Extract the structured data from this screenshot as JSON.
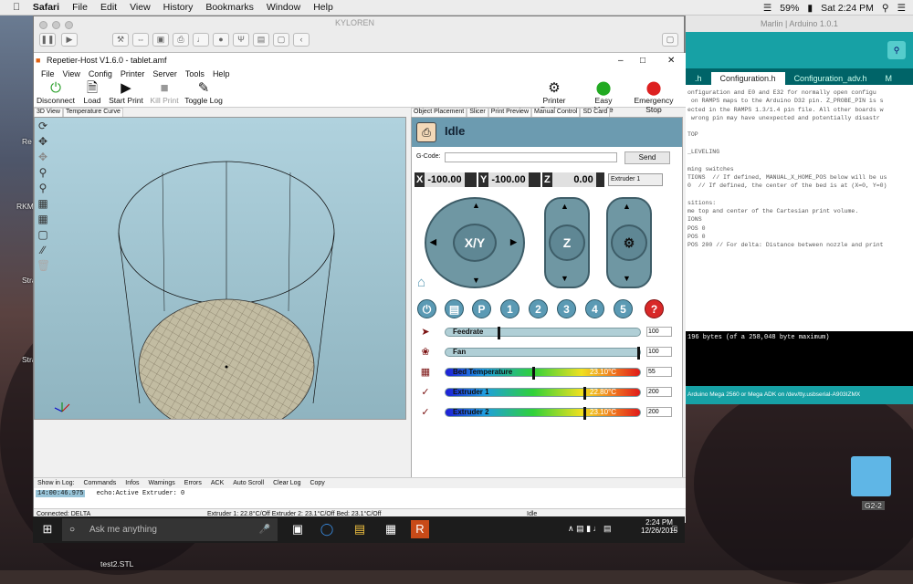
{
  "mac_menubar": {
    "apple": "",
    "items": [
      "Safari",
      "File",
      "Edit",
      "View",
      "History",
      "Bookmarks",
      "Window",
      "Help"
    ],
    "battery": "59%",
    "clock": "Sat 2:24 PM"
  },
  "desktop": {
    "labels": [
      "Re",
      "RKM",
      "Stra",
      "Stra",
      "test2.STL",
      "G2-2"
    ]
  },
  "vm": {
    "title": "KYLOREN"
  },
  "arduino": {
    "title": "Marlin | Arduino 1.0.1",
    "tabs": [
      ".h",
      "Configuration.h",
      "Configuration_adv.h",
      "M"
    ],
    "code": "onfiguration and E0 and E32 for normally open configu\n on RAMPS maps to the Arduino D32 pin. Z_PROBE_PIN is s\nected in the RAMPS 1.3/1.4 pin file. All other boards w\n wrong pin may have unexpected and potentially disastr\n\nTOP\n\n_LEVELING\n\nming switches\nTIONS  // If defined, MANUAL_X_HOME_POS below will be us\n0  // If defined, the center of the bed is at (X=0, Y=0)\n\nsitions:\nme top and center of the Cartesian print volume.\nIONS\nPOS 0\nPOS 0\nPOS 200 // For delta: Distance between nozzle and print",
    "console": "196 bytes (of a 258,048 byte maximum)",
    "footer": "Arduino Mega 2560 or Mega ADK on /dev/tty.usbserial-A903IZMX"
  },
  "repetier": {
    "title": "Repetier-Host V1.6.0 - tablet.amf",
    "menu": [
      "File",
      "View",
      "Config",
      "Printer",
      "Server",
      "Tools",
      "Help"
    ],
    "toolbar": {
      "disconnect": "Disconnect",
      "load": "Load",
      "start": "Start Print",
      "kill": "Kill Print",
      "toggle": "Toggle Log",
      "settings": "Printer Settings",
      "easy": "Easy Mode",
      "emergency": "Emergency Stop"
    },
    "left_tabs": [
      "3D View",
      "Temperature Curve"
    ],
    "right_tabs": [
      "Object Placement",
      "Slicer",
      "Print Preview",
      "Manual Control",
      "SD Card"
    ],
    "state": "Idle",
    "gcode_label": "G-Code:",
    "send": "Send",
    "coords": {
      "x_label": "X",
      "x": "-100.00",
      "y_label": "Y",
      "y": "-100.00",
      "z_label": "Z",
      "z": "0.00"
    },
    "extruder_select": "Extruder 1",
    "pads": {
      "xy": "X/Y",
      "z": "Z"
    },
    "numbers": [
      "1",
      "2",
      "3",
      "4",
      "5"
    ],
    "p_button": "P",
    "help": "?",
    "sliders": [
      {
        "label": "Feedrate",
        "value": "100",
        "level": 0.27
      },
      {
        "label": "Fan",
        "value": "100",
        "level": 1.0
      },
      {
        "label": "Bed Temperature",
        "temp": "23.10°C",
        "value": "55",
        "level": 0.45
      },
      {
        "label": "Extruder 1",
        "temp": "22.80°C",
        "value": "200",
        "level": 0.72
      },
      {
        "label": "Extruder 2",
        "temp": "23.10°C",
        "value": "200",
        "level": 0.72
      }
    ],
    "log": {
      "show": "Show in Log:",
      "items": [
        "Commands",
        "Infos",
        "Warnings",
        "Errors",
        "ACK",
        "Auto Scroll",
        "Clear Log",
        "Copy"
      ],
      "time": "14:00:46.975",
      "message": "echo:Active Extruder: 0"
    },
    "status": {
      "connected": "Connected: DELTA",
      "temps": "Extruder 1: 22.8°C/Off Extruder 2: 23.1°C/Off Bed: 23.1°C/Off",
      "state": "Idle"
    }
  },
  "taskbar": {
    "search": "Ask me anything",
    "time": "2:24 PM",
    "date": "12/26/2015"
  }
}
